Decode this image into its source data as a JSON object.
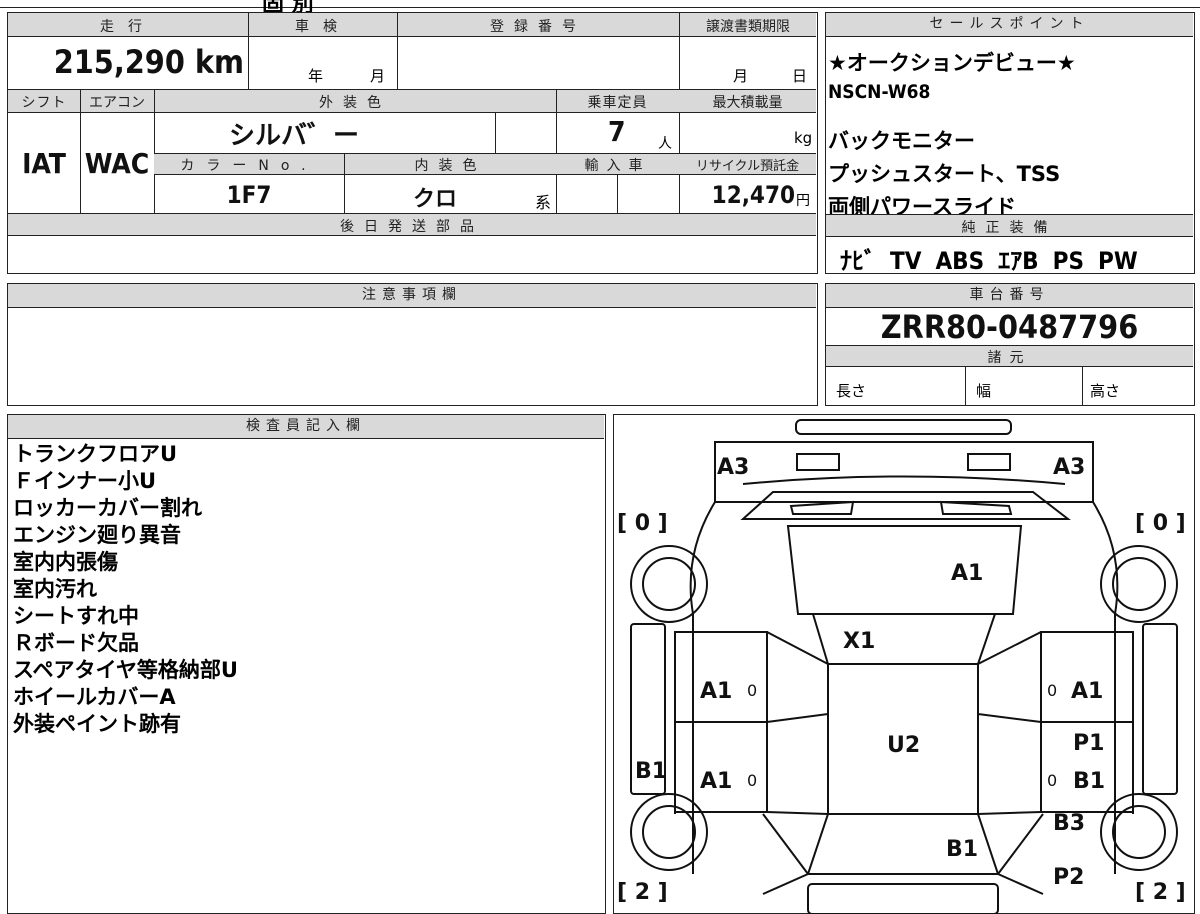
{
  "top_strip": {
    "text": "固 別"
  },
  "mileage": {
    "label": "走行",
    "value": "215,290 km"
  },
  "shaken": {
    "label": "車検",
    "year_label": "年",
    "month_label": "月"
  },
  "registration": {
    "label": "登録番号"
  },
  "transfer_deadline": {
    "label": "譲渡書類期限",
    "month_label": "月",
    "day_label": "日"
  },
  "sales_points": {
    "label": "セールスポイント",
    "items": [
      "★オークションデビュー★",
      "NSCN-W68",
      "バックモニター",
      "プッシュスタート、TSS",
      "両側パワースライド"
    ]
  },
  "shift": {
    "label": "シフト",
    "value": "IAT"
  },
  "aircon": {
    "label": "エアコン",
    "value": "WAC"
  },
  "exterior_color": {
    "label": "外装色",
    "value": "シルバ゛ー"
  },
  "capacity": {
    "label": "乗車定員",
    "value": "7",
    "unit": "人"
  },
  "max_load": {
    "label": "最大積載量",
    "unit": "kg"
  },
  "color_no": {
    "label": "カラーNo.",
    "value": "1F7"
  },
  "interior_color": {
    "label": "内装色",
    "value": "クロ",
    "suffix": "系"
  },
  "import_car": {
    "label": "輸入車"
  },
  "recycle": {
    "label": "リサイクル預託金",
    "value": "12,470",
    "unit": "円"
  },
  "later_parts": {
    "label": "後日発送部品"
  },
  "genuine_equipment": {
    "label": "純正装備",
    "items": [
      "ﾅﾋﾞ",
      "TV",
      "ABS",
      "ｴｱB",
      "PS",
      "PW"
    ]
  },
  "notes": {
    "label": "注意事項欄"
  },
  "chassis": {
    "label": "車台番号",
    "value": "ZRR80-0487796"
  },
  "specs": {
    "label": "諸元",
    "length": "長さ",
    "width": "幅",
    "height": "高さ"
  },
  "inspector": {
    "label": "検査員記入欄",
    "items": [
      "トランクフロアU",
      "Ｆインナー小U",
      "ロッカーカバー割れ",
      "エンジン廻り異音",
      "室内内張傷",
      "室内汚れ",
      "シートすれ中",
      "Ｒボード欠品",
      "スペアタイヤ等格納部U",
      "ホイールカバーA",
      "外装ペイント跡有"
    ]
  },
  "diagram": {
    "labels": {
      "rear_left": "A3",
      "rear_right": "A3",
      "tire_rl": "[ 0 ]",
      "tire_rr": "[ 0 ]",
      "tire_fl": "[ 2 ]",
      "tire_fr": "[ 2 ]",
      "back_door": "A1",
      "rear_glass": "X1",
      "left_rear_door": "A1",
      "left_rear_door_mark": "0",
      "left_front_door": "A1",
      "left_front_door_mark": "0",
      "right_rear_door": "A1",
      "right_rear_door_mark": "0",
      "right_front_door": "B1",
      "right_front_door_mark": "0",
      "right_p1": "P1",
      "roof": "U2",
      "left_sill": "B1",
      "right_fender": "B3",
      "hood": "B1",
      "front_right": "P2"
    }
  }
}
